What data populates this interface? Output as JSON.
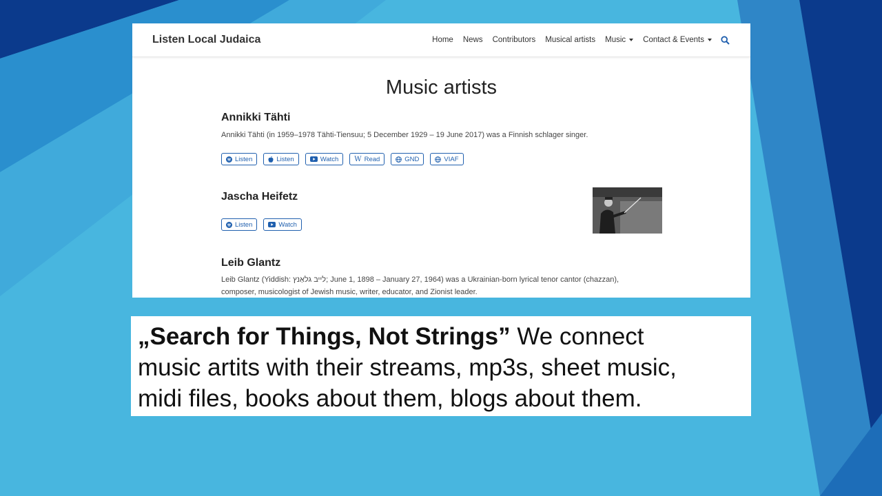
{
  "site": {
    "brand": "Listen Local Judaica",
    "nav": [
      {
        "label": "Home",
        "dropdown": false
      },
      {
        "label": "News",
        "dropdown": false
      },
      {
        "label": "Contributors",
        "dropdown": false
      },
      {
        "label": "Musical artists",
        "dropdown": false
      },
      {
        "label": "Music",
        "dropdown": true
      },
      {
        "label": "Contact & Events",
        "dropdown": true
      }
    ],
    "search_icon": "search-icon",
    "page_title": "Music artists",
    "artists": [
      {
        "name": "Annikki Tähti",
        "description": "Annikki Tähti (in 1959–1978 Tähti-Tiensuu; 5 December 1929 – 19 June 2017) was a Finnish schlager singer.",
        "buttons": [
          {
            "label": "Listen",
            "icon": "spotify-icon"
          },
          {
            "label": "Listen",
            "icon": "apple-icon"
          },
          {
            "label": "Watch",
            "icon": "youtube-icon"
          },
          {
            "label": "Read",
            "icon": "wikipedia-icon"
          },
          {
            "label": "GND",
            "icon": "globe-icon"
          },
          {
            "label": "VIAF",
            "icon": "globe-icon"
          }
        ]
      },
      {
        "name": "Jascha Heifetz",
        "description": "",
        "buttons": [
          {
            "label": "Listen",
            "icon": "spotify-icon"
          },
          {
            "label": "Watch",
            "icon": "youtube-icon"
          }
        ]
      },
      {
        "name": "Leib Glantz",
        "description_line1": "Leib Glantz (Yiddish: לייב גלאַנץ; June 1, 1898 – January 27, 1964) was a Ukrainian-born lyrical tenor cantor (chazzan),",
        "description_line2": "composer, musicologist of Jewish music, writer, educator, and Zionist leader."
      }
    ]
  },
  "caption": {
    "bold": "„Search for Things, Not Strings”",
    "rest_line1": " We connect",
    "line2": "music artits with their streams, mp3s, sheet music,",
    "line3": "midi files,  books about them, blogs about them."
  },
  "colors": {
    "background": "#48b6df",
    "dark_blue": "#0b3a8c",
    "button_blue": "#1f5fae"
  }
}
